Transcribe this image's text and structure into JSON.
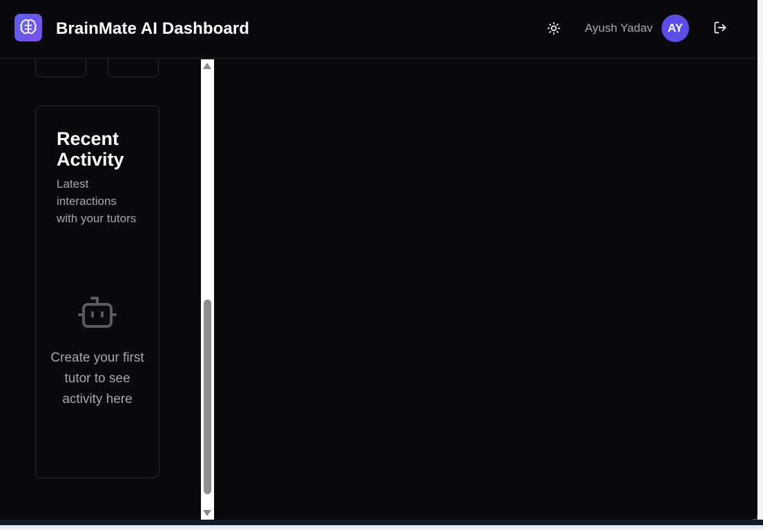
{
  "header": {
    "app_title": "BrainMate AI Dashboard",
    "logo_icon": "brain-icon",
    "theme_icon": "sun-icon",
    "user_name": "Ayush Yadav",
    "avatar_initials": "AY",
    "logout_icon": "logout-icon",
    "accent_color": "#5b4ee8"
  },
  "sidebar": {
    "recent_activity": {
      "title": "Recent Activity",
      "subtitle": "Latest interactions with your tutors",
      "empty_icon": "bot-icon",
      "empty_message": "Create your first tutor to see activity here"
    }
  },
  "scrollbar": {
    "position_fraction": 0.95,
    "visible_fraction": 0.45
  }
}
